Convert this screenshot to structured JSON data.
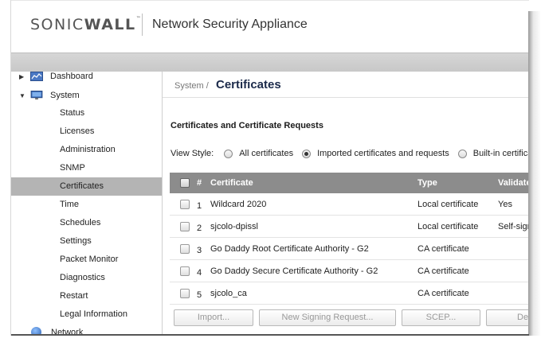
{
  "header": {
    "logo_text_a": "SONIC",
    "logo_text_b": "WALL",
    "logo_tm": "™",
    "app_title": "Network Security Appliance"
  },
  "sidebar": {
    "top_items": [
      {
        "label": "Dashboard",
        "icon": "dashboard-icon",
        "arrow": "▶"
      },
      {
        "label": "System",
        "icon": "monitor-icon",
        "arrow": "▼"
      }
    ],
    "sub_items": [
      {
        "label": "Status"
      },
      {
        "label": "Licenses"
      },
      {
        "label": "Administration"
      },
      {
        "label": "SNMP"
      },
      {
        "label": "Certificates",
        "active": true
      },
      {
        "label": "Time"
      },
      {
        "label": "Schedules"
      },
      {
        "label": "Settings"
      },
      {
        "label": "Packet Monitor"
      },
      {
        "label": "Diagnostics"
      },
      {
        "label": "Restart"
      },
      {
        "label": "Legal Information"
      }
    ],
    "bottom_item": {
      "label": "Network",
      "icon": "globe-icon"
    }
  },
  "main": {
    "breadcrumb": "System /",
    "page_title": "Certificates",
    "section_title": "Certificates and Certificate Requests",
    "view_style": {
      "label": "View Style:",
      "options": [
        {
          "label": "All certificates",
          "checked": false
        },
        {
          "label": "Imported certificates and requests",
          "checked": true
        },
        {
          "label": "Built-in certificates",
          "checked": false
        }
      ]
    },
    "table": {
      "columns": [
        "#",
        "Certificate",
        "Type",
        "Validated"
      ],
      "rows": [
        {
          "num": "1",
          "certificate": "Wildcard 2020",
          "type": "Local certificate",
          "validated": "Yes"
        },
        {
          "num": "2",
          "certificate": "sjcolo-dpissl",
          "type": "Local certificate",
          "validated": "Self-signed"
        },
        {
          "num": "3",
          "certificate": "Go Daddy Root Certificate Authority - G2",
          "type": "CA certificate",
          "validated": ""
        },
        {
          "num": "4",
          "certificate": "Go Daddy Secure Certificate Authority - G2",
          "type": "CA certificate",
          "validated": ""
        },
        {
          "num": "5",
          "certificate": "sjcolo_ca",
          "type": "CA certificate",
          "validated": ""
        }
      ]
    },
    "buttons": [
      "Import...",
      "New Signing Request...",
      "SCEP...",
      "Delete"
    ]
  }
}
